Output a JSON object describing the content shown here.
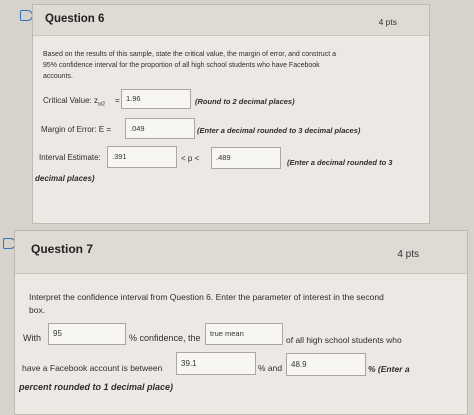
{
  "q6": {
    "title": "Question 6",
    "points": "4 pts",
    "prompt_lines": [
      "Based on the results of this sample, state the critical value, the margin of error, and construct a",
      "95% confidence interval for the proportion of all high school students who have Facebook",
      "accounts."
    ],
    "critical_label": "Critical Value: z",
    "critical_sub": "α/2",
    "critical_eq": "=",
    "critical_value": "1.96",
    "critical_hint": "(Round to 2 decimal places)",
    "margin_label": "Margin of Error: E =",
    "margin_value": ".049",
    "margin_hint": "(Enter a decimal rounded to 3 decimal places)",
    "interval_label": "Interval Estimate:",
    "interval_low": ".391",
    "interval_mid": "< p <",
    "interval_high": ".489",
    "interval_hint": "(Enter a decimal rounded to 3",
    "interval_hint_cont": "decimal places)"
  },
  "q7": {
    "title": "Question 7",
    "points": "4 pts",
    "prompt_line1": "Interpret the confidence interval from Question 6.  Enter the parameter of interest in the second",
    "prompt_line2": "box.",
    "with_label": "With",
    "conf_value": "95",
    "conf_text": "% confidence, the",
    "param_value": "true mean",
    "of_all_text": "of all high school students who",
    "fb_text": "have a Facebook account is between",
    "low_value": "39.1",
    "and_text": "% and",
    "high_value": "48.9",
    "enter_text": "% (Enter a",
    "percent_text": "percent rounded to 1 decimal place)"
  },
  "colors": {
    "accent": "#3a6fb8",
    "background": "#d6d2cc",
    "card": "#ece9e4",
    "header": "#dedad4"
  },
  "icons": [
    "bookmark-flag-icon"
  ]
}
